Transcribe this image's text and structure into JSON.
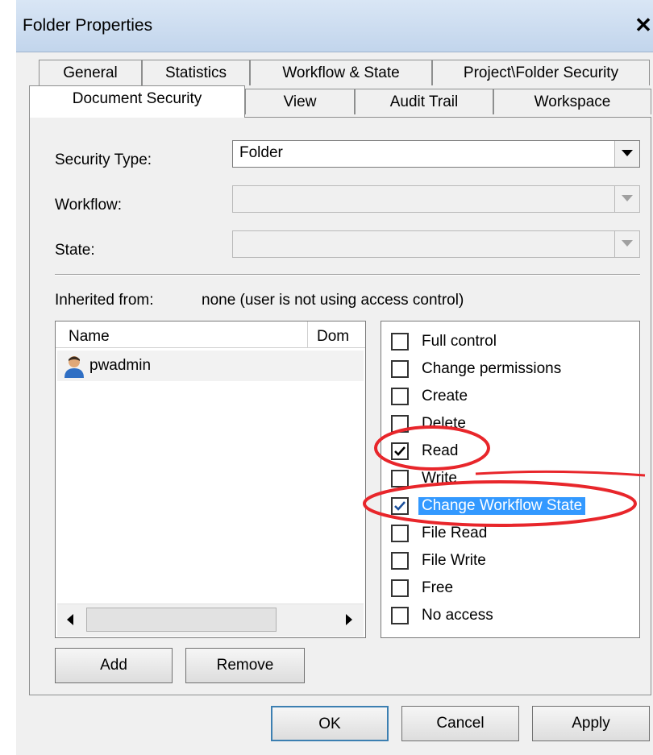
{
  "window": {
    "title": "Folder Properties",
    "close_glyph": "✕"
  },
  "tabs": {
    "row1": [
      "General",
      "Statistics",
      "Workflow & State",
      "Project\\Folder Security"
    ],
    "row2": [
      "Document Security",
      "View",
      "Audit Trail",
      "Workspace"
    ],
    "active": "Document Security"
  },
  "form": {
    "security_type_label": "Security Type:",
    "security_type_value": "Folder",
    "workflow_label": "Workflow:",
    "workflow_value": "",
    "state_label": "State:",
    "state_value": ""
  },
  "inherited": {
    "label": "Inherited from:",
    "value": "none (user is not using access control)"
  },
  "users": {
    "columns": [
      "Name",
      "Dom"
    ],
    "rows": [
      {
        "name": "pwadmin",
        "icon": "user-icon"
      }
    ]
  },
  "permissions": [
    {
      "label": "Full control",
      "checked": false
    },
    {
      "label": "Change permissions",
      "checked": false
    },
    {
      "label": "Create",
      "checked": false
    },
    {
      "label": "Delete",
      "checked": false
    },
    {
      "label": "Read",
      "checked": true
    },
    {
      "label": "Write",
      "checked": false
    },
    {
      "label": "Change Workflow State",
      "checked": true,
      "selected": true
    },
    {
      "label": "File Read",
      "checked": false
    },
    {
      "label": "File Write",
      "checked": false
    },
    {
      "label": "Free",
      "checked": false
    },
    {
      "label": "No access",
      "checked": false
    }
  ],
  "buttons": {
    "add": "Add",
    "remove": "Remove",
    "ok": "OK",
    "cancel": "Cancel",
    "apply": "Apply"
  },
  "colors": {
    "selection": "#3399ff",
    "annotation": "#e8262b"
  }
}
